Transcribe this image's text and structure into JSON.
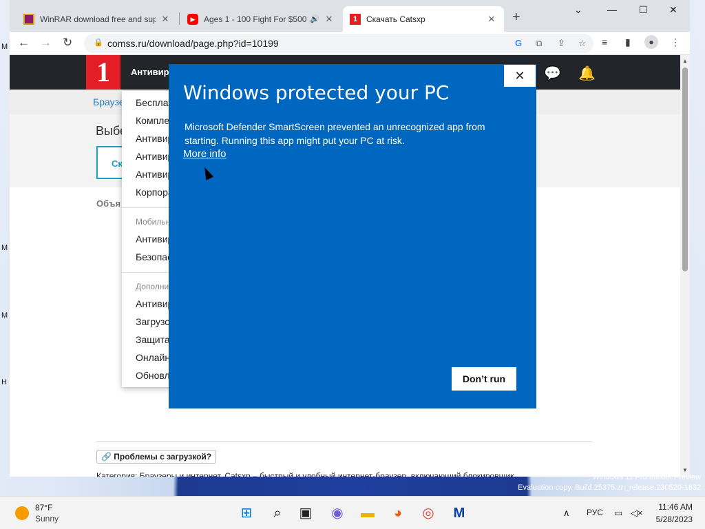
{
  "desktop": {
    "labels": [
      "M",
      "M",
      "M",
      "H"
    ],
    "watermark_line1": "Windows 11 Pro Insider Preview",
    "watermark_line2": "Evaluation copy. Build 25375.zn_release.230520-1632"
  },
  "browser": {
    "tabs": [
      {
        "title": "WinRAR download free and supp",
        "favicon": "winrar-icon",
        "color": "#8b1a6b"
      },
      {
        "title": "Ages 1 - 100 Fight For $500,",
        "favicon": "youtube-icon",
        "color": "#ff0000",
        "audio": "🔊"
      },
      {
        "title": "Скачать Catsxp",
        "favicon": "comss-icon",
        "color": "#e31e24"
      }
    ],
    "close_glyph": "✕",
    "new_tab": "+",
    "url": "comss.ru/download/page.php?id=10199"
  },
  "site": {
    "logo": "1",
    "nav_label": "Антивир",
    "breadcrumb": "Браузе",
    "choose_title": "Выбе",
    "download_label": "Ск",
    "obj_label": "Объя",
    "dropdown": {
      "group1": [
        "Бесплат",
        "Компле",
        "Антивир",
        "Антивир",
        "Антивир",
        "Корпора"
      ],
      "group2_heading": "Мобильн",
      "group2": [
        "Антивир",
        "Безопас"
      ],
      "group3_heading": "Дополнит",
      "group3": [
        "Антивир",
        "Загрузо",
        "Защита",
        "Онлайн",
        "Обновл"
      ]
    },
    "problem_button": "🔗 Проблемы с загрузкой?",
    "bottom_text": "Категория: Браузеры и интернет. Catsxp – быстрый и удобный интернет-браузер, включающий блокировщик"
  },
  "dialog": {
    "title": "Windows protected your PC",
    "message": "Microsoft Defender SmartScreen prevented an unrecognized app from starting. Running this app might put your PC at risk.",
    "more_info": "More info",
    "dont_run": "Don’t run",
    "close": "✕"
  },
  "taskbar": {
    "weather_temp": "87°F",
    "weather_cond": "Sunny",
    "language": "РУС",
    "time": "11:46 AM",
    "date": "5/28/2023"
  }
}
